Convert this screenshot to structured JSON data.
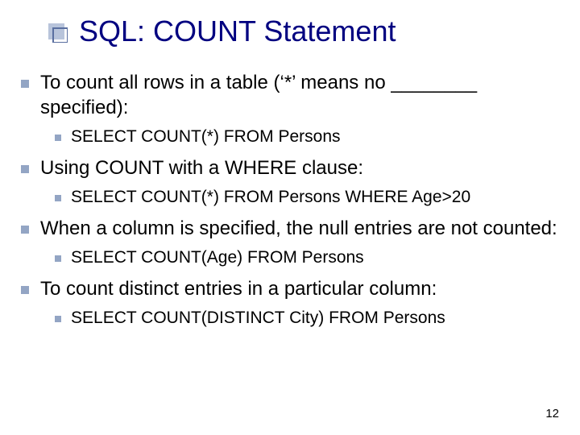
{
  "title": "SQL: COUNT Statement",
  "bullet1": "To count all rows in a table (‘*’ means no ________ specified):",
  "bullet1_sub1": "SELECT COUNT(*) FROM Persons",
  "bullet2": "Using COUNT with a WHERE clause:",
  "bullet2_sub1": "SELECT COUNT(*) FROM Persons WHERE Age>20",
  "bullet3": "When a column is specified, the null entries are not counted:",
  "bullet3_sub1": "SELECT COUNT(Age) FROM Persons",
  "bullet4": "To count distinct entries in a particular column:",
  "bullet4_sub1": "SELECT COUNT(DISTINCT City) FROM Persons",
  "page_number": "12"
}
